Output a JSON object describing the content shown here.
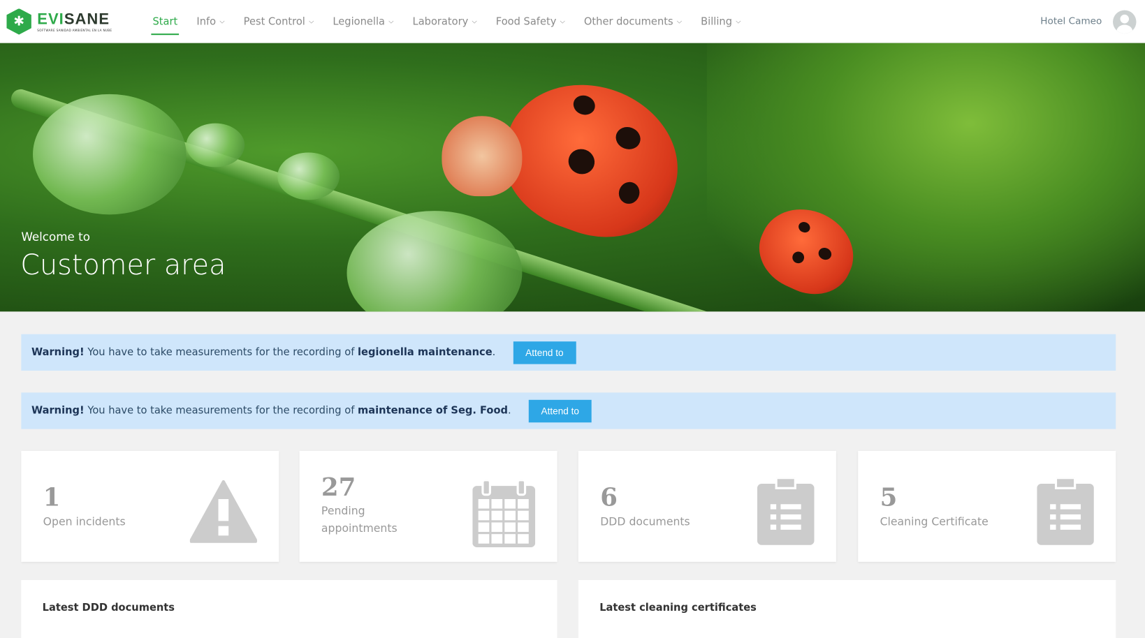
{
  "brand": {
    "name_a": "EVI",
    "name_b": "SANE",
    "tagline": "SOFTWARE SANIDAD AMBIENTAL EN LA NUBE"
  },
  "nav": {
    "items": [
      {
        "label": "Start",
        "active": true
      },
      {
        "label": "Info"
      },
      {
        "label": "Pest Control"
      },
      {
        "label": "Legionella"
      },
      {
        "label": "Laboratory"
      },
      {
        "label": "Food Safety"
      },
      {
        "label": "Other documents"
      },
      {
        "label": "Billing"
      }
    ],
    "user": "Hotel Cameo"
  },
  "hero": {
    "welcome": "Welcome to",
    "title": "Customer area"
  },
  "alerts": [
    {
      "strong": "Warning!",
      "text": " You have to take measurements for the recording of ",
      "item": "legionella maintenance",
      "end": ".",
      "button": "Attend to"
    },
    {
      "strong": "Warning!",
      "text": " You have to take measurements for the recording of ",
      "item": "maintenance of Seg. Food",
      "end": ".",
      "button": "Attend to"
    }
  ],
  "cards": [
    {
      "value": "1",
      "label": "Open incidents",
      "icon": "warning-icon"
    },
    {
      "value": "27",
      "label": "Pending appointments",
      "icon": "calendar-icon"
    },
    {
      "value": "6",
      "label": "DDD documents",
      "icon": "clipboard-icon"
    },
    {
      "value": "5",
      "label": "Cleaning Certificate",
      "icon": "clipboard-icon"
    }
  ],
  "panels": {
    "left": "Latest DDD documents",
    "right": "Latest cleaning certificates"
  },
  "colors": {
    "accent": "#2eaa4a",
    "alert_bg": "#cfe6fb",
    "button": "#2ea7e6"
  }
}
